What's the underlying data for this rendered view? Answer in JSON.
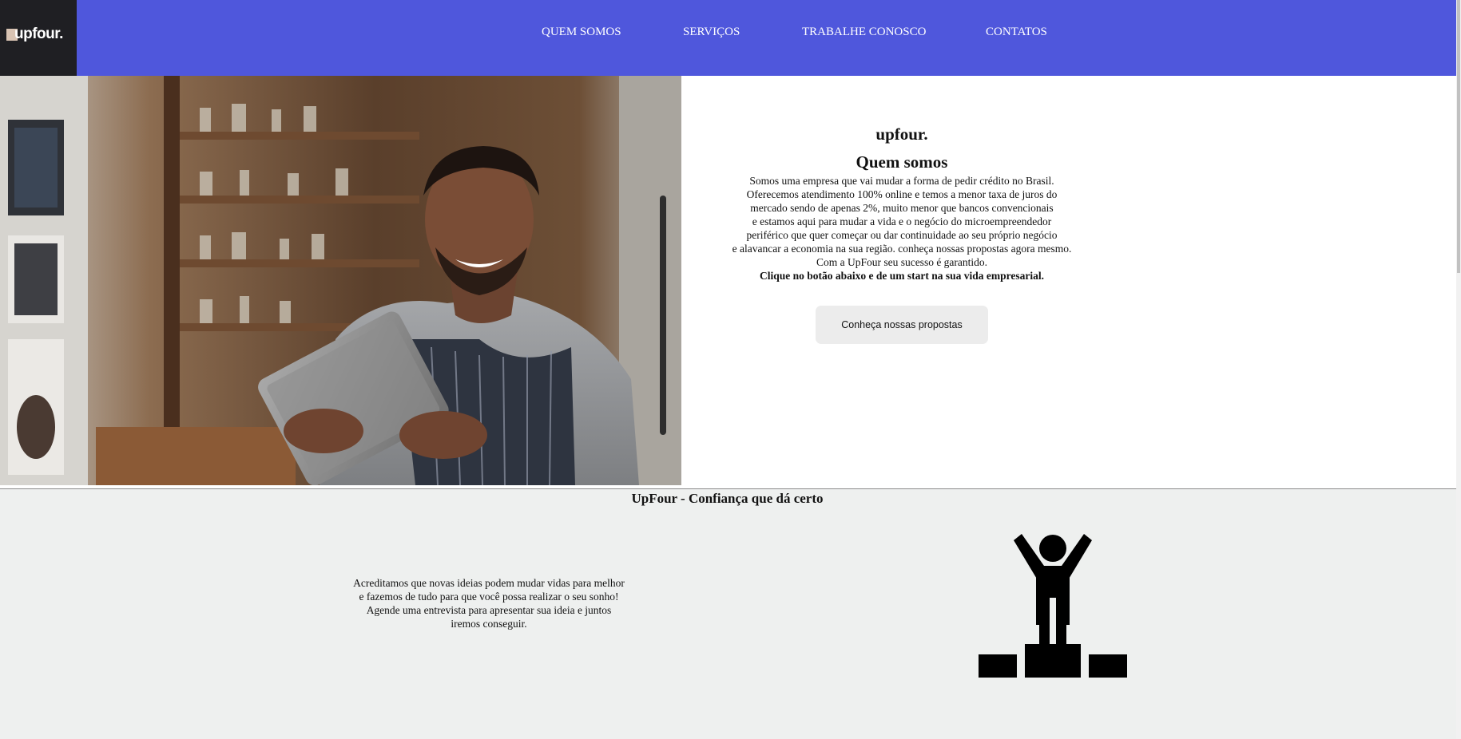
{
  "header": {
    "logo_text": "upfour.",
    "logo_tagline": "",
    "nav": [
      {
        "label": "QUEM SOMOS"
      },
      {
        "label": "SERVIÇOS"
      },
      {
        "label": "TRABALHE CONOSCO"
      },
      {
        "label": "CONTATOS"
      }
    ]
  },
  "about": {
    "brand": "upfour.",
    "title": "Quem somos",
    "lines": [
      "Somos uma empresa que vai mudar a forma de pedir crédito no Brasil.",
      "Oferecemos atendimento 100% online e temos a menor taxa de juros do",
      "mercado sendo de apenas 2%, muito menor que bancos convencionais",
      "e estamos aqui para mudar a vida e o negócio do microempreendedor",
      "periférico que quer começar ou dar continuidade ao seu próprio negócio",
      "e alavancar a economia na sua região. conheça nossas propostas agora mesmo.",
      "Com a UpFour seu sucesso é garantido."
    ],
    "highlight": "Clique no botão abaixo e de um start na sua vida empresarial.",
    "cta_label": "Conheça nossas propostas"
  },
  "lower": {
    "title": "UpFour - Confiança que dá certo",
    "lines": [
      "Acreditamos que novas ideias podem mudar vidas para melhor",
      "e fazemos de tudo para que você possa realizar o seu sonho!",
      "Agende uma entrevista para apresentar sua ideia e juntos",
      "iremos conseguir."
    ]
  },
  "colors": {
    "header_bg": "#4f57dc",
    "logo_bg": "#1f1f23",
    "lower_bg": "#eef0ef",
    "button_bg": "#ececec"
  },
  "icons": {
    "hero_image": "man-with-tablet-photo",
    "feature_icon": "podium-winner-icon"
  }
}
